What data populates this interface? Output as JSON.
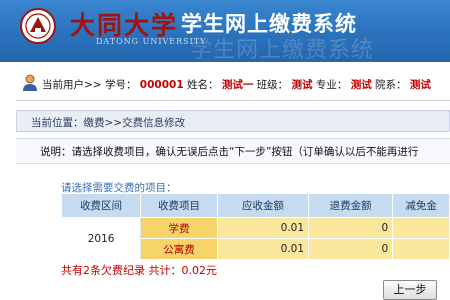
{
  "header": {
    "university_cn": "大同大学",
    "university_en": "DATONG UNIVERSITY",
    "system_title": "学生网上缴费系统",
    "ghost_text": "学生网上缴费系统"
  },
  "user": {
    "current_user_label": "当前用户>>",
    "student_id_label": "学号：",
    "student_id": "000001",
    "name_label": "姓名：",
    "name": "测试一",
    "class_label": "班级：",
    "class": "测试",
    "major_label": "专业：",
    "major": "测试",
    "dept_label": "院系：",
    "dept": "测试"
  },
  "breadcrumb": "当前位置：缴费>>交费信息修改",
  "notice": "说明：请选择收费项目，确认无误后点击“下一步”按钮（订单确认以后不能再进行",
  "choose_label": "请选择需要交费的项目：",
  "table": {
    "headers": [
      "收费区间",
      "收费项目",
      "应收金额",
      "退费金额",
      "减免金"
    ],
    "year": "2016",
    "rows": [
      {
        "item": "学费",
        "due": "0.01",
        "refund": "0",
        "reduce": ""
      },
      {
        "item": "公寓费",
        "due": "0.01",
        "refund": "0",
        "reduce": ""
      }
    ]
  },
  "summary": "共有2条欠费纪录  共计：0.02元",
  "buttons": {
    "next": "上一步"
  },
  "colors": {
    "header_blue": "#2b72bd",
    "accent_red": "#c40000",
    "row_yellow": "#f7d46a"
  }
}
